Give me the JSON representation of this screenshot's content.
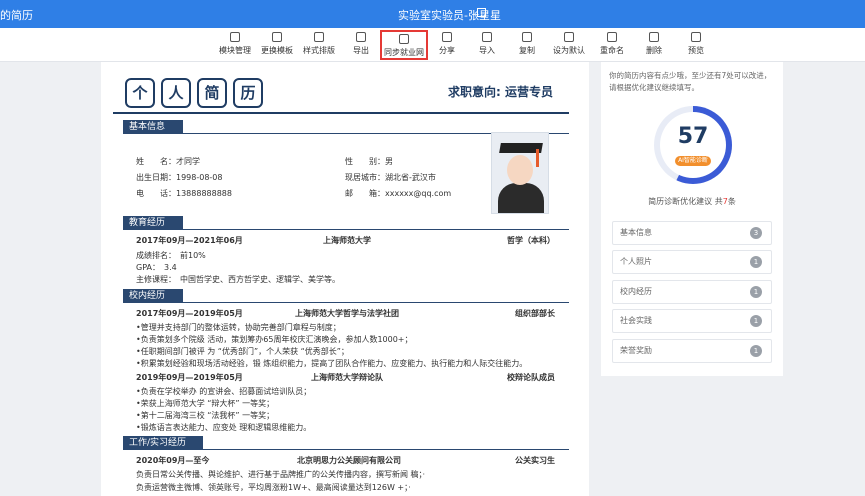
{
  "topbar": {
    "app": "的简历",
    "title": "实验室实验员-张星星"
  },
  "toolbar": [
    {
      "label": "模块管理"
    },
    {
      "label": "更换模板"
    },
    {
      "label": "样式排版"
    },
    {
      "label": "导出"
    },
    {
      "label": "同步就业网"
    },
    {
      "label": "分享"
    },
    {
      "label": "导入"
    },
    {
      "label": "复制"
    },
    {
      "label": "设为默认"
    },
    {
      "label": "重命名"
    },
    {
      "label": "删除"
    },
    {
      "label": "预览"
    }
  ],
  "resume": {
    "title_chars": [
      "个",
      "人",
      "简",
      "历"
    ],
    "intent": "求职意向: 运营专员",
    "sections": {
      "basic": "基本信息",
      "edu": "教育经历",
      "campus": "校内经历",
      "work": "工作/实习经历"
    },
    "basic": {
      "name": "姓　　名：才同学",
      "birth": "出生日期：1998-08-08",
      "phone": "电　　话：13888888888",
      "gender": "性　　别：男",
      "city": "现居城市：湖北省-武汉市",
      "email": "邮　　箱：xxxxxx@qq.com"
    },
    "edu": {
      "period": "2017年09月—2021年06月",
      "school": "上海师范大学",
      "degree": "哲学（本科）",
      "rank": "成绩排名：　前10%",
      "gpa": "GPA：　3.4",
      "courses": "主修课程：　中国哲学史、西方哲学史、逻辑学、美学等。"
    },
    "campus": [
      {
        "period": "2017年09月—2019年05月",
        "org": "上海师范大学哲学与法学社团",
        "role": "组织部部长",
        "lines": [
          "•管理并支持部门的整体运转，协助完善部门章程与制度；",
          "•负责策划多个院级 活动，策划筹办65周年校庆汇演晚会，参加人数1000+；",
          "•任职期间部门被评 为 “优秀部门”，个人荣获 “优秀部长”；",
          "•积累策划经验和现场活动经验，锻 炼组织能力，提高了团队合作能力、应变能力、执行能力和人际交往能力。"
        ]
      },
      {
        "period": "2019年09月—2019年05月",
        "org": "上海师范大学辩论队",
        "role": "校辩论队成员",
        "lines": [
          "•负责在学校举办 的宣讲会、招募面试培训队员；",
          "•荣获上海师范大学 “辩大杯” 一等奖；",
          "•第十二届海湾三校 “法我杯” 一等奖；",
          "•锻炼语言表达能力、应变处 理和逻辑思维能力。"
        ]
      }
    ],
    "work": {
      "period": "2020年09月—至今",
      "company": "北京明思力公关顾问有限公司",
      "role": "公关实习生",
      "lines": [
        "负责日常公关传播、舆论维护、进行基于品牌推广的公关传播内容，撰写新闻 稿；·",
        "负责运营微主微博、领英账号，平均周涨粉1W+、最高阅读量达到126W +；·"
      ]
    }
  },
  "panel": {
    "hint": "你的简历内容有点少哦，至少还有7处可以改进，请根据优化建议继续填写。",
    "score": "57",
    "ai_label": "AI智能诊断",
    "sub_prefix": "简历诊断优化建议 共",
    "sub_count": "7",
    "sub_suffix": "条",
    "items": [
      {
        "label": "基本信息",
        "count": "3"
      },
      {
        "label": "个人照片",
        "count": "1"
      },
      {
        "label": "校内经历",
        "count": "1"
      },
      {
        "label": "社会实践",
        "count": "1"
      },
      {
        "label": "荣誉奖励",
        "count": "1"
      }
    ],
    "accent": "#3b5bd6"
  }
}
